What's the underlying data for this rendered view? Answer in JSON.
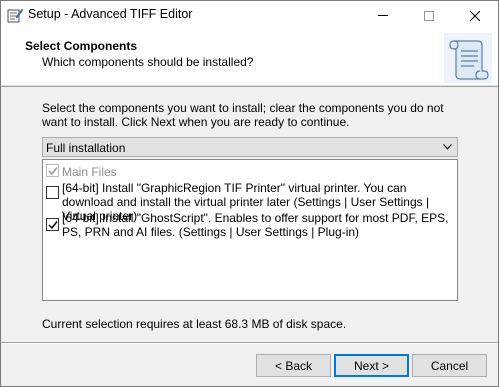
{
  "window": {
    "title": "Setup - Advanced TIFF Editor"
  },
  "header": {
    "title": "Select Components",
    "subtitle": "Which components should be installed?",
    "image_icon": "scroll-setup-icon"
  },
  "instructions": "Select the components you want to install; clear the components you do not want to install. Click Next when you are ready to continue.",
  "install_type": {
    "selected": "Full installation"
  },
  "components": [
    {
      "label": "Main Files",
      "checked": true,
      "disabled": true
    },
    {
      "label": "[64-bit] Install \"GraphicRegion TIF Printer\" virtual printer. You can download and install the virtual printer later (Settings | User Settings | Virtual printer)",
      "checked": false,
      "disabled": false
    },
    {
      "label": "[64-bit] Install \"GhostScript\". Enables to offer support for most PDF, EPS, PS, PRN and AI files. (Settings | User Settings | Plug-in)",
      "checked": true,
      "disabled": false
    }
  ],
  "disk_space": "Current selection requires at least 68.3 MB of disk space.",
  "buttons": {
    "back": "< Back",
    "next": "Next >",
    "cancel": "Cancel"
  },
  "colors": {
    "accent": "#0078d7",
    "button_face": "#e1e1e1",
    "dialog_bg": "#f0f0f0"
  }
}
